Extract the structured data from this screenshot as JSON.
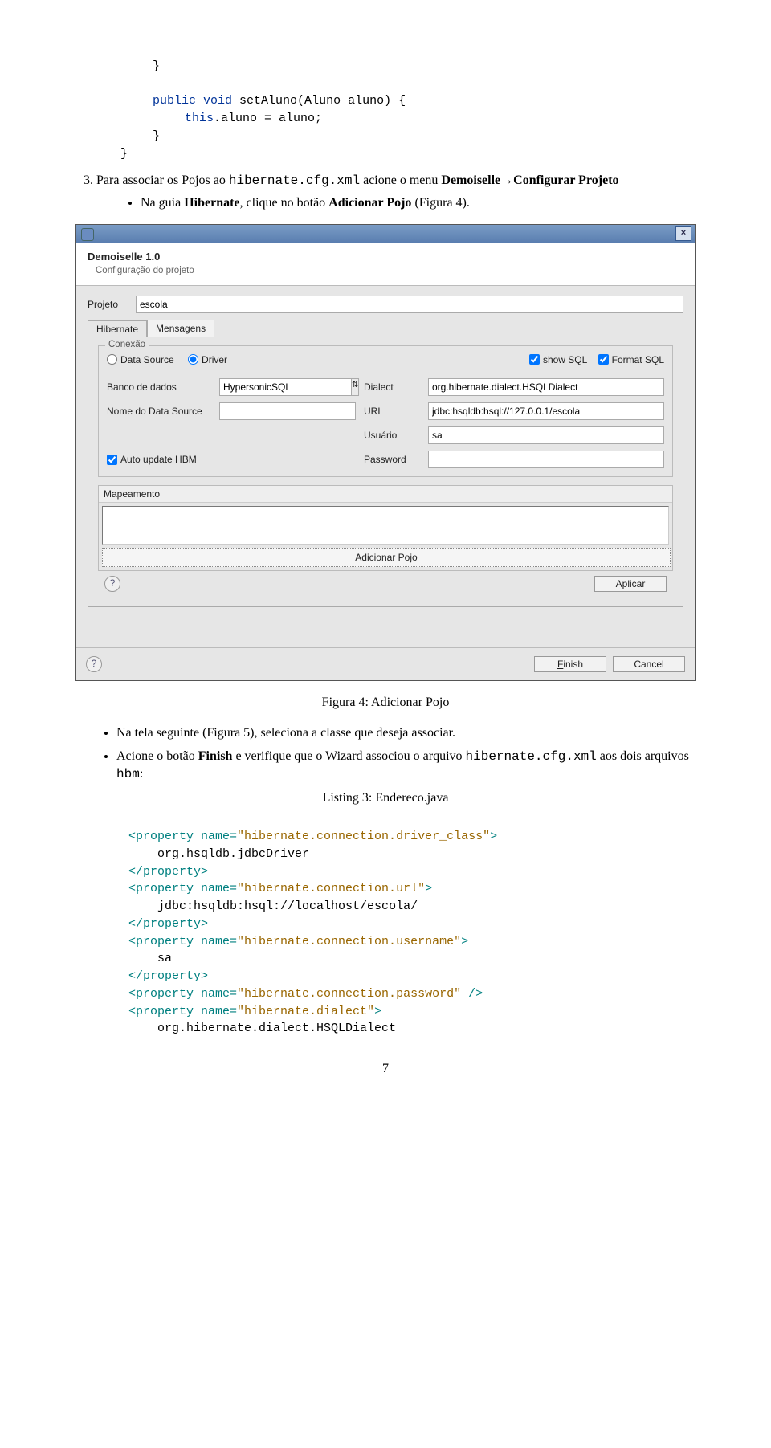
{
  "code_top": {
    "l1": "}",
    "l2a": "public",
    "l2b": "void",
    "l2c": " setAluno(Aluno aluno) {",
    "l3a": "this",
    "l3b": ".aluno = aluno;",
    "l4": "}",
    "l5": "}"
  },
  "step3": {
    "number": "3.",
    "text_a": "Para associar os Pojos ao ",
    "tt1": "hibernate.cfg.xml",
    "text_b": " acione o menu ",
    "bold1": "Demoiselle→Configurar Projeto",
    "bullet1_a": "Na guia ",
    "bullet1_bold": "Hibernate",
    "bullet1_b": ", clique no botão ",
    "bullet1_bold2": "Adicionar Pojo",
    "bullet1_c": " (Figura 4)."
  },
  "dialog": {
    "close": "×",
    "header_title": "Demoiselle 1.0",
    "header_sub": "Configuração do projeto",
    "projeto_label": "Projeto",
    "projeto_value": "escola",
    "tab_hibernate": "Hibernate",
    "tab_mensagens": "Mensagens",
    "group_conexao": "Conexão",
    "radio_ds": "Data Source",
    "radio_driver": "Driver",
    "chk_showsql": "show SQL",
    "chk_formatsql": "Format SQL",
    "lbl_banco": "Banco de dados",
    "sel_banco": "HypersonicSQL",
    "lbl_dialect": "Dialect",
    "val_dialect": "org.hibernate.dialect.HSQLDialect",
    "lbl_nomeds": "Nome do Data Source",
    "val_nomeds": "",
    "lbl_url": "URL",
    "val_url": "jdbc:hsqldb:hsql://127.0.0.1/escola",
    "lbl_usuario": "Usuário",
    "val_usuario": "sa",
    "chk_autoupdate": "Auto update HBM",
    "lbl_password": "Password",
    "val_password": "",
    "mapping_legend": "Mapeamento",
    "add_pojo": "Adicionar Pojo",
    "help": "?",
    "btn_aplicar": "Aplicar",
    "btn_finish": "Finish",
    "btn_cancel": "Cancel"
  },
  "fig4_caption": "Figura 4: Adicionar Pojo",
  "bullets2": {
    "b1_a": "Na tela seguinte (Figura 5), seleciona a classe que deseja associar.",
    "b2_a": "Acione o botão ",
    "b2_bold": "Finish",
    "b2_b": " e verifique que o Wizard associou o arquivo ",
    "b2_tt": "hibernate.cfg.xml",
    "b2_c": " aos dois arquivos ",
    "b2_tt2": "hbm",
    "b2_d": ":"
  },
  "listing_caption": "Listing 3: Endereco.java",
  "xml": {
    "prop_open": "<property",
    "name_attr": " name=",
    "close_tag": ">",
    "end_prop": "</property>",
    "selfclose": " />",
    "n1": "\"hibernate.connection.driver_class\"",
    "v1": "org.hsqldb.jdbcDriver",
    "n2": "\"hibernate.connection.url\"",
    "v2": "jdbc:hsqldb:hsql://localhost/escola/",
    "n3": "\"hibernate.connection.username\"",
    "v3": "sa",
    "n4": "\"hibernate.connection.password\"",
    "n5": "\"hibernate.dialect\"",
    "v5": "org.hibernate.dialect.HSQLDialect"
  },
  "pagenum": "7"
}
